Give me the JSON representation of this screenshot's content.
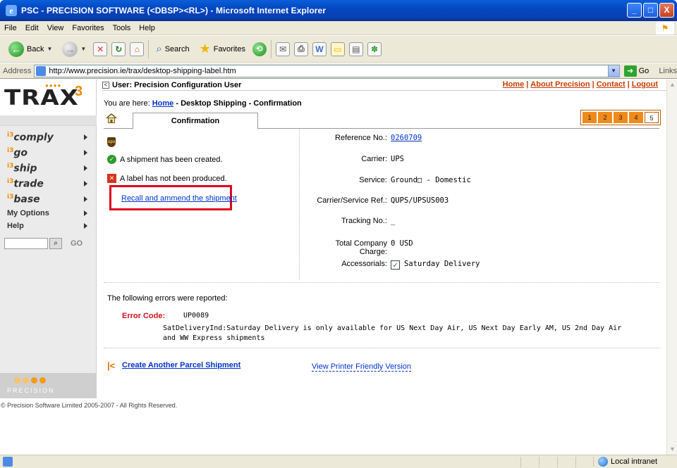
{
  "window": {
    "title": "PSC - PRECISION SOFTWARE (<DBSP><RL>) - Microsoft Internet Explorer",
    "controls": [
      "_",
      "□",
      "X"
    ]
  },
  "menu": [
    "File",
    "Edit",
    "View",
    "Favorites",
    "Tools",
    "Help"
  ],
  "toolbar": {
    "back_label": "Back",
    "search_label": "Search",
    "favorites_label": "Favorites"
  },
  "address": {
    "label": "Address",
    "url": "http://www.precision.ie/trax/desktop-shipping-label.htm",
    "go_label": "Go",
    "links_label": "Links"
  },
  "sidebar": {
    "logo_text": "TRAX",
    "logo_version": "3",
    "items": [
      {
        "label": "comply",
        "sup": "i3"
      },
      {
        "label": "go",
        "sup": "i3"
      },
      {
        "label": "ship",
        "sup": "i3"
      },
      {
        "label": "trade",
        "sup": "i3"
      },
      {
        "label": "base",
        "sup": "i3"
      }
    ],
    "my_options": "My Options",
    "help": "Help",
    "go_text": "GO",
    "precision_text": "PRECISION"
  },
  "userbar": {
    "user_label": "User: Precision Configuration User",
    "links": [
      "Home",
      "About Precision",
      "Contact",
      "Logout"
    ]
  },
  "breadcrumb": {
    "prefix": "You are here:",
    "home": "Home",
    "rest": "- Desktop Shipping - Confirmation"
  },
  "tab": {
    "label": "Confirmation"
  },
  "steps": [
    "1",
    "2",
    "3",
    "4",
    "5"
  ],
  "status": {
    "created": "A shipment has been created.",
    "label_error": "A label has not been produced.",
    "recall_link": "Recall and ammend the shipment"
  },
  "details": {
    "reference_label": "Reference No.:",
    "reference_value": "0260709",
    "carrier_label": "Carrier:",
    "carrier_value": "UPS",
    "service_label": "Service:",
    "service_value": "Ground□ - Domestic",
    "ref_label": "Carrier/Service Ref.:",
    "ref_value": "QUPS/UPSUS003",
    "tracking_label": "Tracking No.:",
    "tracking_value": "_",
    "charge_label_1": "Total Company",
    "charge_label_2": "Charge:",
    "charge_value": "0 USD",
    "accessorials_label": "Accessorials:",
    "accessorials_value": "Saturday Delivery"
  },
  "errors": {
    "intro": "The following errors were reported:",
    "code_label": "Error Code:",
    "code_value": "UP0089",
    "message_line1": "SatDeliveryInd:Saturday Delivery is only available for US Next Day Air, US Next Day Early AM, US 2nd Day Air",
    "message_line2": "and WW Express shipments"
  },
  "actions": {
    "create_link": "Create Another Parcel Shipment",
    "printer_link": "View Printer Friendly Version"
  },
  "copyright": "© Precision Software Limited 2005-2007 - All Rights Reserved.",
  "statusbar": {
    "zone": "Local intranet"
  }
}
